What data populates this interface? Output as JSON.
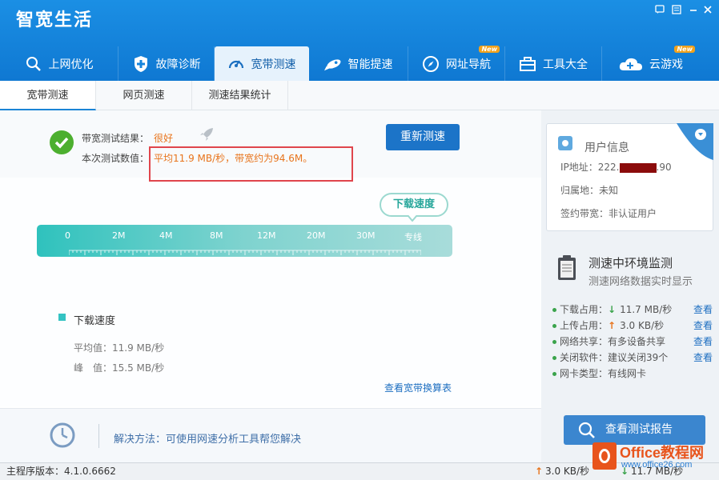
{
  "app": {
    "title": "智宽生活"
  },
  "nav": [
    {
      "label": "上网优化",
      "icon": "search-icon",
      "badge": ""
    },
    {
      "label": "故障诊断",
      "icon": "shield-plus-icon",
      "badge": ""
    },
    {
      "label": "宽带测速",
      "icon": "speedometer-icon",
      "badge": ""
    },
    {
      "label": "智能提速",
      "icon": "rocket-icon",
      "badge": ""
    },
    {
      "label": "网址导航",
      "icon": "compass-icon",
      "badge": "New"
    },
    {
      "label": "工具大全",
      "icon": "toolbox-icon",
      "badge": ""
    },
    {
      "label": "云游戏",
      "icon": "cloud-game-icon",
      "badge": "New"
    }
  ],
  "tabs": [
    "宽带测速",
    "网页测速",
    "测速结果统计"
  ],
  "result": {
    "label1": "带宽测试结果：",
    "value1": "很好",
    "label2": "本次测试数值：",
    "value2": "平均11.9 MB/秒，带宽约为94.6M。",
    "retest": "重新测速"
  },
  "gauge": {
    "bubble": "下载速度",
    "ticks": [
      "0",
      "2M",
      "4M",
      "8M",
      "12M",
      "20M",
      "30M",
      "专线"
    ]
  },
  "download": {
    "legend": "下载速度",
    "avg": "平均值：11.9 MB/秒",
    "peak": "峰　值：15.5 MB/秒",
    "table_link": "查看宽带换算表"
  },
  "solution": "解决方法：可使用网速分析工具帮您解决",
  "user_info": {
    "title": "用户信息",
    "ip_prefix": "IP地址：222.",
    "ip_suffix": ".90",
    "location": "归属地：未知",
    "contract": "签约带宽：非认证用户"
  },
  "monitor": {
    "title": "测速中环境监测",
    "subtitle": "测速网络数据实时显示",
    "items": [
      {
        "label": "下载占用：",
        "value": "11.7 MB/秒",
        "link": "查看",
        "arrow": "↓"
      },
      {
        "label": "上传占用：",
        "value": "3.0 KB/秒",
        "link": "查看",
        "arrow": "↑"
      },
      {
        "label": "网络共享：",
        "value": "有多设备共享",
        "link": "查看",
        "arrow": ""
      },
      {
        "label": "关闭软件：",
        "value": "建议关闭39个",
        "link": "查看",
        "arrow": ""
      },
      {
        "label": "网卡类型：",
        "value": "有线网卡",
        "link": "",
        "arrow": ""
      }
    ],
    "report_button": "查看测试报告"
  },
  "statusbar": {
    "version": "主程序版本：4.1.0.6662",
    "upload": "3.0 KB/秒",
    "download": "11.7 MB/秒"
  },
  "watermark": {
    "brand": "Office教程网",
    "url": "www.office26.com"
  },
  "colors": {
    "header": "#1584dc",
    "accent": "#1c74c8",
    "orange": "#e8741c",
    "teal": "#2fc2bd",
    "highlight_box": "#e0454c"
  }
}
